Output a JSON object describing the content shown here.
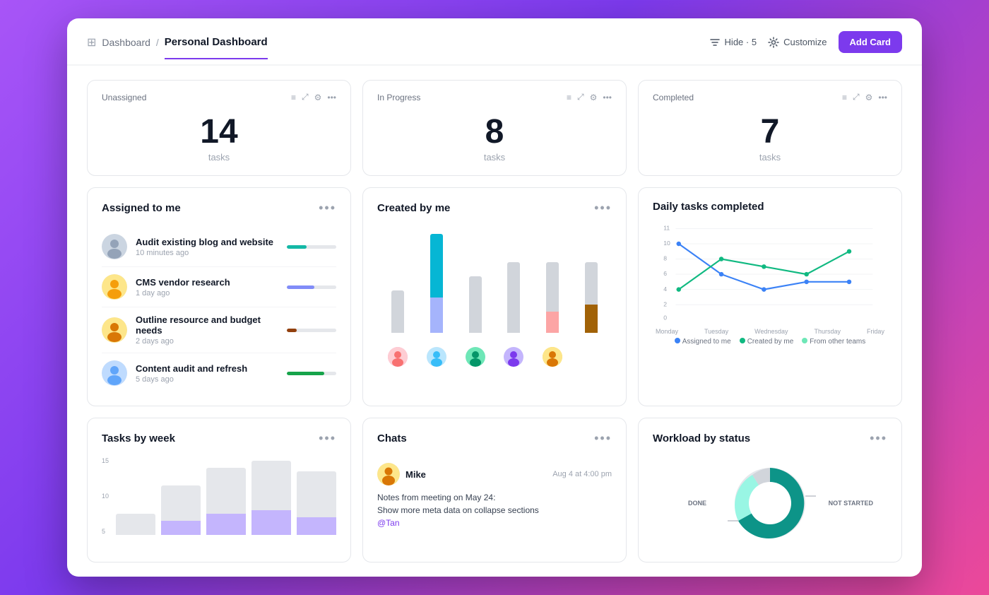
{
  "header": {
    "breadcrumb_home": "Dashboard",
    "breadcrumb_sep": "/",
    "breadcrumb_current": "Personal Dashboard",
    "hide_btn": "Hide · 5",
    "customize_btn": "Customize",
    "add_card_btn": "Add Card"
  },
  "stats": [
    {
      "label": "Unassigned",
      "number": "14",
      "unit": "tasks"
    },
    {
      "label": "In Progress",
      "number": "8",
      "unit": "tasks"
    },
    {
      "label": "Completed",
      "number": "7",
      "unit": "tasks"
    }
  ],
  "assigned_to_me": {
    "title": "Assigned to me",
    "tasks": [
      {
        "name": "Audit existing blog and website",
        "time": "10 minutes ago",
        "progress": 40,
        "color": "#14b8a6"
      },
      {
        "name": "CMS vendor research",
        "time": "1 day ago",
        "progress": 55,
        "color": "#818cf8"
      },
      {
        "name": "Outline resource and budget needs",
        "time": "2 days ago",
        "progress": 20,
        "color": "#a16207"
      },
      {
        "name": "Content audit and refresh",
        "time": "5 days ago",
        "progress": 75,
        "color": "#16a34a"
      }
    ]
  },
  "created_by_me": {
    "title": "Created by me"
  },
  "daily_tasks": {
    "title": "Daily tasks completed",
    "legend": [
      "Assigned to me",
      "Created by me",
      "From other teams"
    ],
    "x_labels": [
      "Monday",
      "Tuesday",
      "Wednesday",
      "Thursday",
      "Friday"
    ]
  },
  "tasks_by_week": {
    "title": "Tasks by week",
    "y_labels": [
      "15",
      "10",
      "5"
    ]
  },
  "chats": {
    "title": "Chats",
    "sender": "Mike",
    "time": "Aug 4 at 4:00 pm",
    "message_line1": "Notes from meeting on May 24:",
    "message_line2": "Show more meta data on collapse sections",
    "tag": "@Tan"
  },
  "workload": {
    "title": "Workload by status",
    "label_done": "DONE",
    "label_not_started": "NOT STARTED"
  }
}
